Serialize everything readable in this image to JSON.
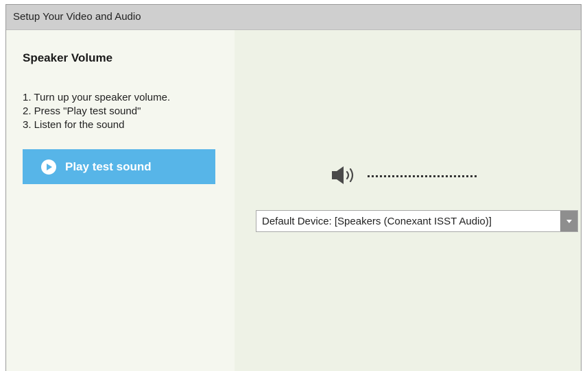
{
  "window": {
    "title": "Setup Your Video and Audio"
  },
  "left": {
    "heading": "Speaker Volume",
    "steps": [
      "1. Turn up your speaker volume.",
      "2. Press \"Play test sound\"",
      "3. Listen for the sound"
    ],
    "play_button_label": "Play test sound"
  },
  "right": {
    "speaker_icon": "speaker-icon",
    "volume_level": 0,
    "device_select_value": "Default Device: [Speakers (Conexant ISST Audio)]"
  },
  "colors": {
    "accent": "#57b5e8",
    "titlebar": "#cfcfcf",
    "panel_bg": "#f2f5ec"
  }
}
